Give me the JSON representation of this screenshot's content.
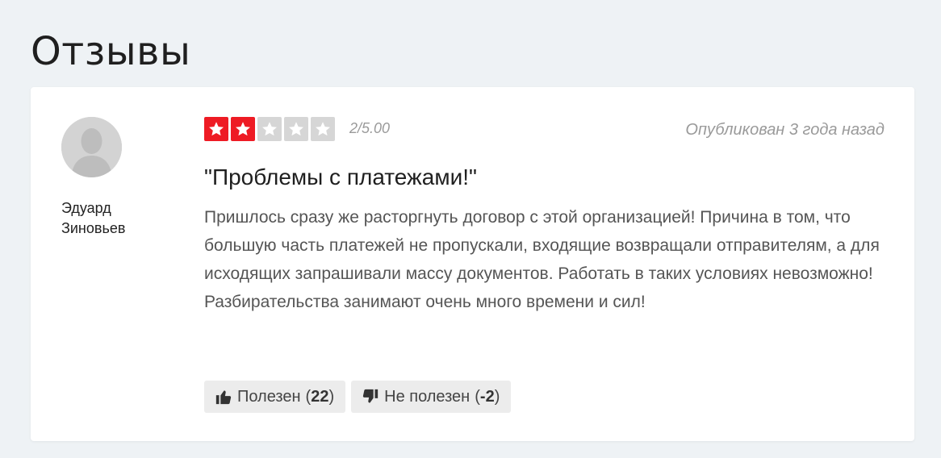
{
  "section": {
    "title": "Отзывы"
  },
  "review": {
    "author_first": "Эдуард",
    "author_last": "Зиновьев",
    "rating": 2,
    "rating_max": 5,
    "score_text": "2/5.00",
    "published": "Опубликован 3 года назад",
    "title": "\"Проблемы с платежами!\"",
    "text": "Пришлось сразу же расторгнуть договор с этой организацией! Причина в том, что большую часть платежей не пропускали, входящие возвращали отправителям, а для исходящих запрашивали массу документов. Работать в таких условиях невозможно! Разбирательства занимают очень много времени и сил!",
    "helpful": {
      "label": "Полезен",
      "count": "22"
    },
    "not_helpful": {
      "label": "Не полезен",
      "count": "-2"
    }
  },
  "colors": {
    "star_on": "#ee1b24",
    "star_off": "#d6d6d6",
    "background": "#eef2f5"
  }
}
